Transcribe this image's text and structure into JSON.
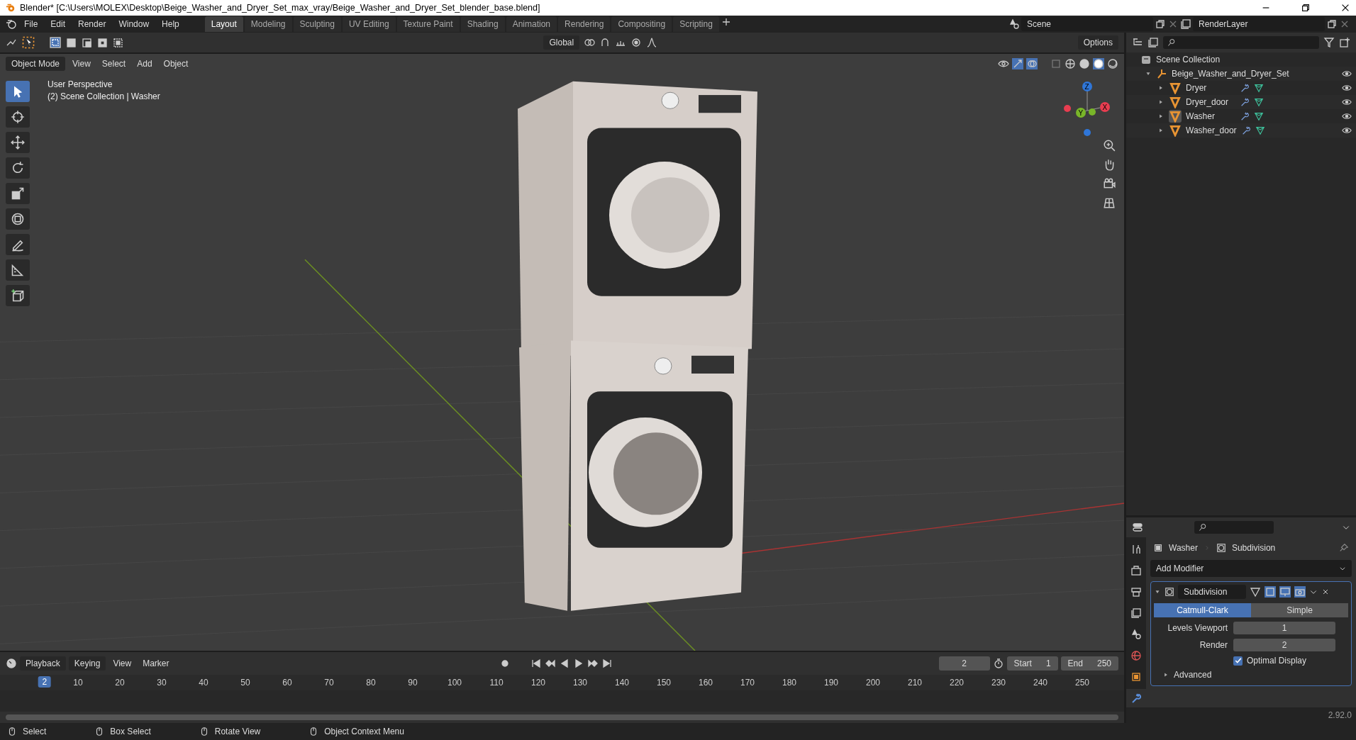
{
  "window": {
    "title": "Blender* [C:\\Users\\MOLEX\\Desktop\\Beige_Washer_and_Dryer_Set_max_vray/Beige_Washer_and_Dryer_Set_blender_base.blend]"
  },
  "menu": [
    "File",
    "Edit",
    "Render",
    "Window",
    "Help"
  ],
  "workspace_tabs": [
    {
      "label": "Layout",
      "selected": true
    },
    {
      "label": "Modeling",
      "selected": false
    },
    {
      "label": "Sculpting",
      "selected": false
    },
    {
      "label": "UV Editing",
      "selected": false
    },
    {
      "label": "Texture Paint",
      "selected": false
    },
    {
      "label": "Shading",
      "selected": false
    },
    {
      "label": "Animation",
      "selected": false
    },
    {
      "label": "Rendering",
      "selected": false
    },
    {
      "label": "Compositing",
      "selected": false
    },
    {
      "label": "Scripting",
      "selected": false
    }
  ],
  "scene": {
    "scene": "Scene",
    "view_layer": "RenderLayer"
  },
  "tool_header": {
    "orientation": "Global",
    "options": "Options"
  },
  "viewport_header": {
    "mode": "Object Mode",
    "menus": [
      "View",
      "Select",
      "Add",
      "Object"
    ]
  },
  "tools": [
    {
      "kind": "select",
      "selected": true
    },
    {
      "kind": "cursor",
      "selected": false
    },
    {
      "kind": "move",
      "selected": false
    },
    {
      "kind": "rotate",
      "selected": false
    },
    {
      "kind": "scale",
      "selected": false
    },
    {
      "kind": "transform",
      "selected": false
    },
    {
      "kind": "annotate",
      "selected": false
    },
    {
      "kind": "measure",
      "selected": false
    },
    {
      "kind": "add-cube",
      "selected": false
    }
  ],
  "viewport": {
    "perspective": "User Perspective",
    "collection": "(2) Scene Collection | Washer"
  },
  "gizmo": {
    "z": "Z",
    "y": "Y",
    "x": "X"
  },
  "outliner": {
    "root": "Scene Collection",
    "items": [
      {
        "label": "Beige_Washer_and_Dryer_Set",
        "expanded": true,
        "children": [
          {
            "label": "Dryer",
            "selected": false
          },
          {
            "label": "Dryer_door",
            "selected": false
          },
          {
            "label": "Washer",
            "selected": true
          },
          {
            "label": "Washer_door",
            "selected": false
          }
        ]
      }
    ]
  },
  "properties": {
    "tabs": [
      {
        "kind": "tool",
        "selected": false
      },
      {
        "kind": "render",
        "selected": false
      },
      {
        "kind": "output",
        "selected": false
      },
      {
        "kind": "view-layer",
        "selected": false
      },
      {
        "kind": "scene",
        "selected": false
      },
      {
        "kind": "world",
        "selected": false
      },
      {
        "kind": "object",
        "selected": false
      },
      {
        "kind": "modifier",
        "selected": true
      }
    ],
    "breadcrumb": [
      "Washer",
      "Subdivision"
    ],
    "add_modifier": "Add Modifier",
    "modifier": {
      "name": "Subdivision",
      "expanded": true,
      "types": [
        {
          "label": "Catmull-Clark",
          "selected": true
        },
        {
          "label": "Simple",
          "selected": false
        }
      ],
      "fields": [
        {
          "label": "Levels Viewport",
          "value": "1"
        },
        {
          "label": "Render",
          "value": "2"
        }
      ],
      "optimal_display": {
        "label": "Optimal Display",
        "checked": true
      },
      "advanced": "Advanced"
    }
  },
  "timeline": {
    "menus": [
      "Playback",
      "Keying",
      "View",
      "Marker"
    ],
    "current_frame": "2",
    "playhead": "2",
    "start": {
      "label": "Start",
      "value": "1"
    },
    "end": {
      "label": "End",
      "value": "250"
    },
    "ruler": [
      "10",
      "20",
      "30",
      "40",
      "50",
      "60",
      "70",
      "80",
      "90",
      "100",
      "110",
      "120",
      "130",
      "140",
      "150",
      "160",
      "170",
      "180",
      "190",
      "200",
      "210",
      "220",
      "230",
      "240",
      "250"
    ]
  },
  "status_bar": {
    "hints": [
      "Select",
      "Box Select",
      "Rotate View",
      "Object Context Menu"
    ],
    "version": "2.92.0"
  }
}
